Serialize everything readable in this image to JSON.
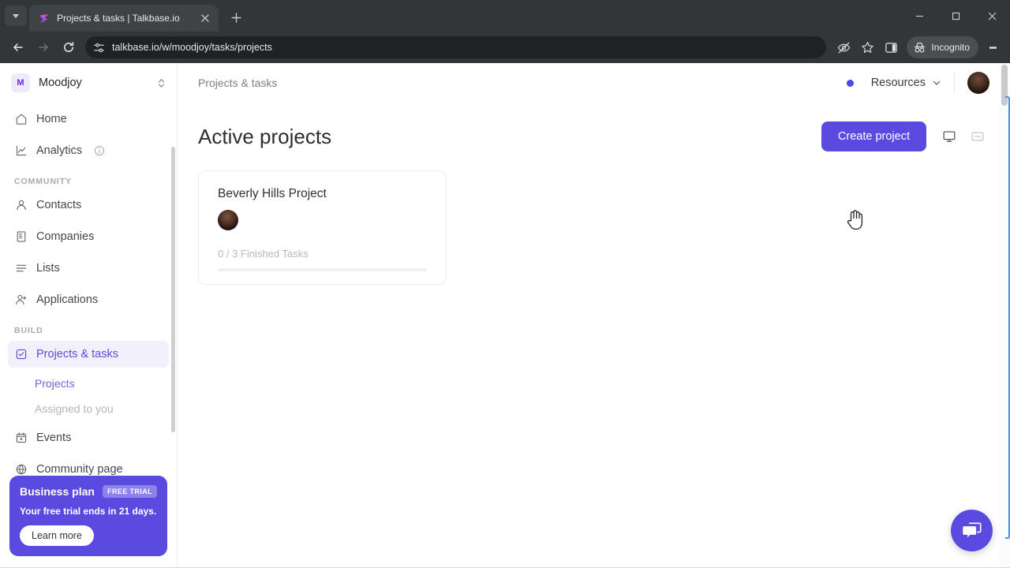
{
  "browser": {
    "tab": {
      "title": "Projects & tasks | Talkbase.io",
      "favicon": "talkbase-logo-icon",
      "close": "close-icon"
    },
    "new_tab_label": "+",
    "tab_list_icon": "chevron-down-icon",
    "window_controls": {
      "minimize": "minimize-icon",
      "maximize": "maximize-icon",
      "close": "close-window-icon"
    },
    "nav": {
      "back": "back-arrow-icon",
      "forward": "forward-arrow-icon",
      "reload": "reload-icon"
    },
    "omnibox": {
      "site_settings_icon": "tune-icon",
      "url": "talkbase.io/w/moodjoy/tasks/projects"
    },
    "actions": {
      "tracking_protection": "eye-off-icon",
      "bookmark": "star-icon",
      "side_panel": "side-panel-icon",
      "incognito_label": "Incognito",
      "incognito_icon": "incognito-icon",
      "menu": "kebab-menu-icon"
    }
  },
  "sidebar": {
    "workspace": {
      "initial": "M",
      "name": "Moodjoy",
      "switch_icon": "chevron-up-down-icon"
    },
    "items": [
      {
        "label": "Home",
        "icon": "home-icon",
        "active": false
      },
      {
        "label": "Analytics",
        "icon": "chart-line-icon",
        "active": false,
        "info_icon": "info-icon"
      }
    ],
    "sections": [
      {
        "title": "COMMUNITY",
        "items": [
          {
            "label": "Contacts",
            "icon": "person-icon"
          },
          {
            "label": "Companies",
            "icon": "building-icon"
          },
          {
            "label": "Lists",
            "icon": "list-icon"
          },
          {
            "label": "Applications",
            "icon": "person-add-icon"
          }
        ]
      },
      {
        "title": "BUILD",
        "items": [
          {
            "label": "Projects & tasks",
            "icon": "check-square-icon",
            "active": true
          },
          {
            "label": "Projects",
            "sub": true,
            "selected": true
          },
          {
            "label": "Assigned to you",
            "sub": true,
            "selected": false
          },
          {
            "label": "Events",
            "icon": "calendar-icon"
          },
          {
            "label": "Community page",
            "icon": "globe-icon"
          }
        ]
      }
    ],
    "plan_card": {
      "title": "Business plan",
      "badge": "FREE TRIAL",
      "subtitle": "Your free trial ends in 21 days.",
      "button": "Learn more",
      "color": "#5b4ae0"
    }
  },
  "topbar": {
    "breadcrumb": "Projects & tasks",
    "status_dot_color": "#4f46e5",
    "resources_label": "Resources",
    "resources_caret": "chevron-down-icon",
    "avatar": "user-avatar"
  },
  "page": {
    "title": "Active projects",
    "create_button": "Create project",
    "view_board_icon": "board-view-icon",
    "view_list_icon": "list-view-icon"
  },
  "projects": [
    {
      "name": "Beverly Hills Project",
      "avatar": "member-avatar",
      "tasks_label": "0 / 3 Finished Tasks",
      "finished": 0,
      "total": 3,
      "progress_percent": 0
    }
  ],
  "chat": {
    "icon": "chat-bubble-icon",
    "color": "#5b4ae0"
  }
}
